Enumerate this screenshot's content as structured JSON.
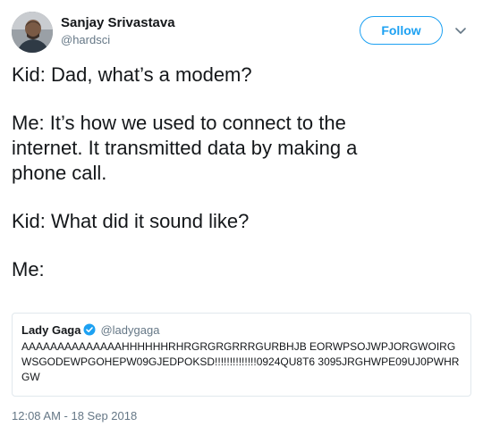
{
  "author": {
    "display_name": "Sanjay Srivastava",
    "handle": "@hardsci"
  },
  "actions": {
    "follow_label": "Follow",
    "menu_icon": "chevron-down-icon"
  },
  "tweet": {
    "paragraphs": [
      "Kid: Dad, what’s a modem?",
      "Me: It’s how we used to connect to the\ninternet. It transmitted data by making a\nphone call.",
      "Kid: What did it sound like?",
      "Me:"
    ],
    "timestamp": "12:08 AM - 18 Sep 2018"
  },
  "quoted_tweet": {
    "display_name": "Lady Gaga",
    "verified_icon": "verified-badge-icon",
    "handle": "@ladygaga",
    "text": "AAAAAAAAAAAAAAHHHHHHRHRGRGRGRRRGURBHJB EORWPSOJWPJORGWOIRGWSGODEWPGOHEPW09GJEDPOKSD!!!!!!!!!!!!!!0924QU8T6 3095JRGHWPE09UJ0PWHRGW"
  },
  "colors": {
    "accent": "#1da1f2",
    "text_primary": "#14171a",
    "text_secondary": "#657786",
    "border": "#e1e8ed"
  }
}
